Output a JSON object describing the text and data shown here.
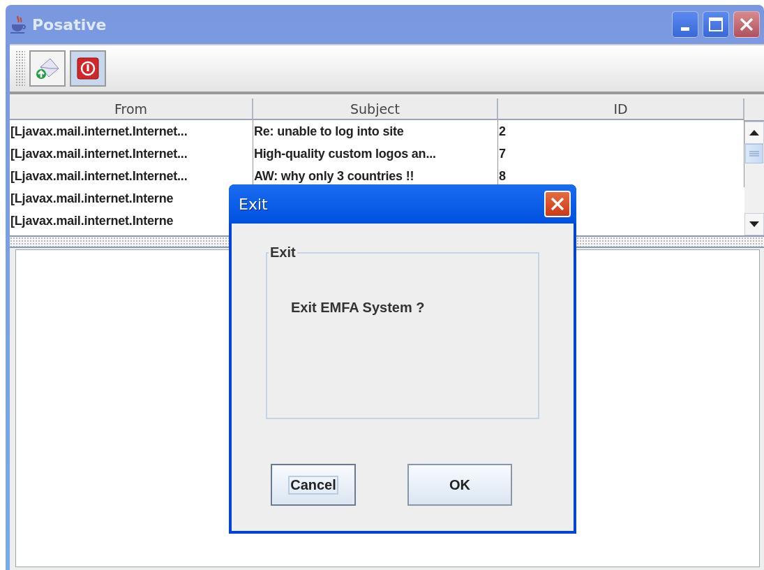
{
  "window": {
    "title": "Posative"
  },
  "toolbar": [
    {
      "kind": "send",
      "highlighted": false
    },
    {
      "kind": "power",
      "highlighted": true
    }
  ],
  "table": {
    "columns": [
      "From",
      "Subject",
      "ID"
    ],
    "rows": [
      {
        "cells": [
          "[Ljavax.mail.internet.Internet...",
          "Re: unable to log into site",
          "2"
        ]
      },
      {
        "cells": [
          "[Ljavax.mail.internet.Internet...",
          "High-quality custom logos an...",
          "7"
        ]
      },
      {
        "cells": [
          "[Ljavax.mail.internet.Internet...",
          "AW: why only 3 countries !!",
          "8"
        ]
      },
      {
        "cells": [
          "[Ljavax.mail.internet.Interne"
        ]
      },
      {
        "cells": [
          "[Ljavax.mail.internet.Interne"
        ]
      }
    ]
  },
  "dialog": {
    "title": "Exit",
    "group_title": "Exit",
    "message": "Exit EMFA System ?",
    "buttons": [
      {
        "label": "Cancel",
        "focused": true
      },
      {
        "label": "OK",
        "focused": false
      }
    ]
  }
}
